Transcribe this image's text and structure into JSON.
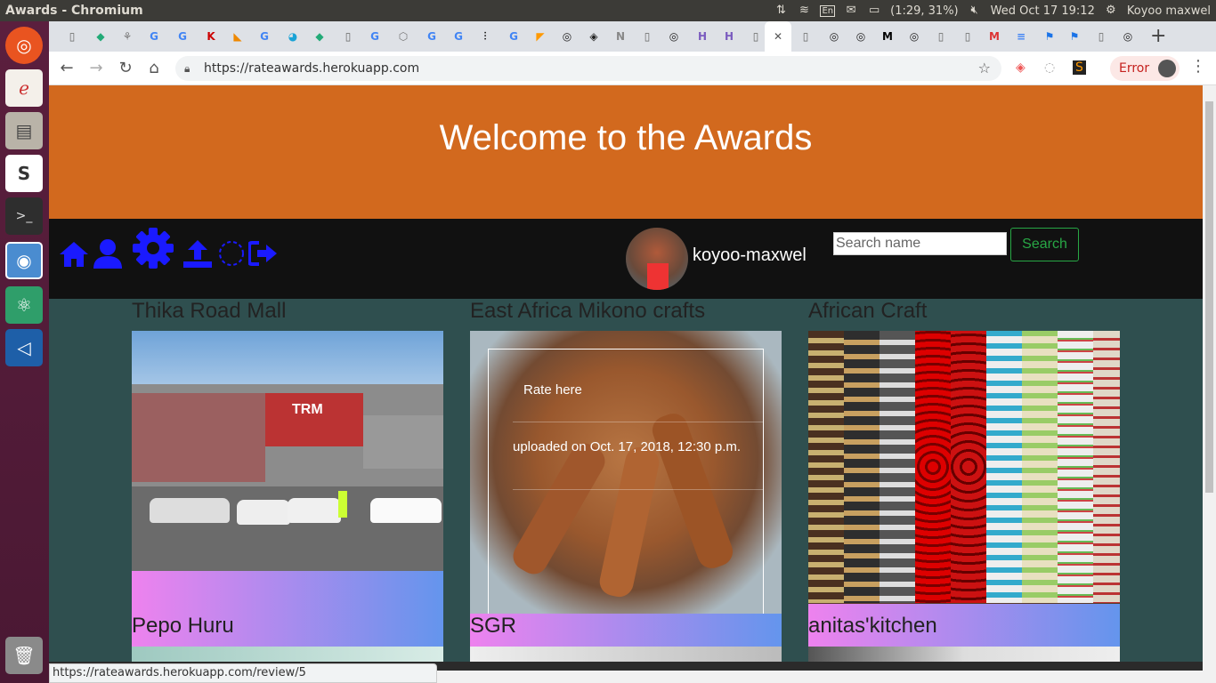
{
  "system": {
    "window_title": "Awards - Chromium",
    "keyboard": "En",
    "battery": "(1:29, 31%)",
    "datetime": "Wed Oct 17 19:12",
    "user": "Koyoo maxwel"
  },
  "browser": {
    "url": "https://rateawards.herokuapp.com",
    "error_label": "Error",
    "status_url": "https://rateawards.herokuapp.com/review/5"
  },
  "page": {
    "banner_title": "Welcome to the Awards",
    "username": "koyoo-maxwel",
    "search_placeholder": "Search name",
    "search_button": "Search",
    "projects": [
      {
        "title": "Thika Road Mall",
        "name": "Pepo Huru"
      },
      {
        "title": "East Africa Mikono crafts",
        "name": "SGR",
        "rate_link": "Rate here",
        "uploaded": "uploaded on Oct. 17, 2018, 12:30 p.m."
      },
      {
        "title": "African Craft",
        "name": "anitas'kitchen"
      }
    ],
    "mall_sign": "TRM"
  },
  "colors": {
    "banner": "#d2691e",
    "navbar": "#111111",
    "page_bg": "#2f4f4f",
    "nav_icon": "#1a1aff",
    "search_btn": "#28a745"
  }
}
